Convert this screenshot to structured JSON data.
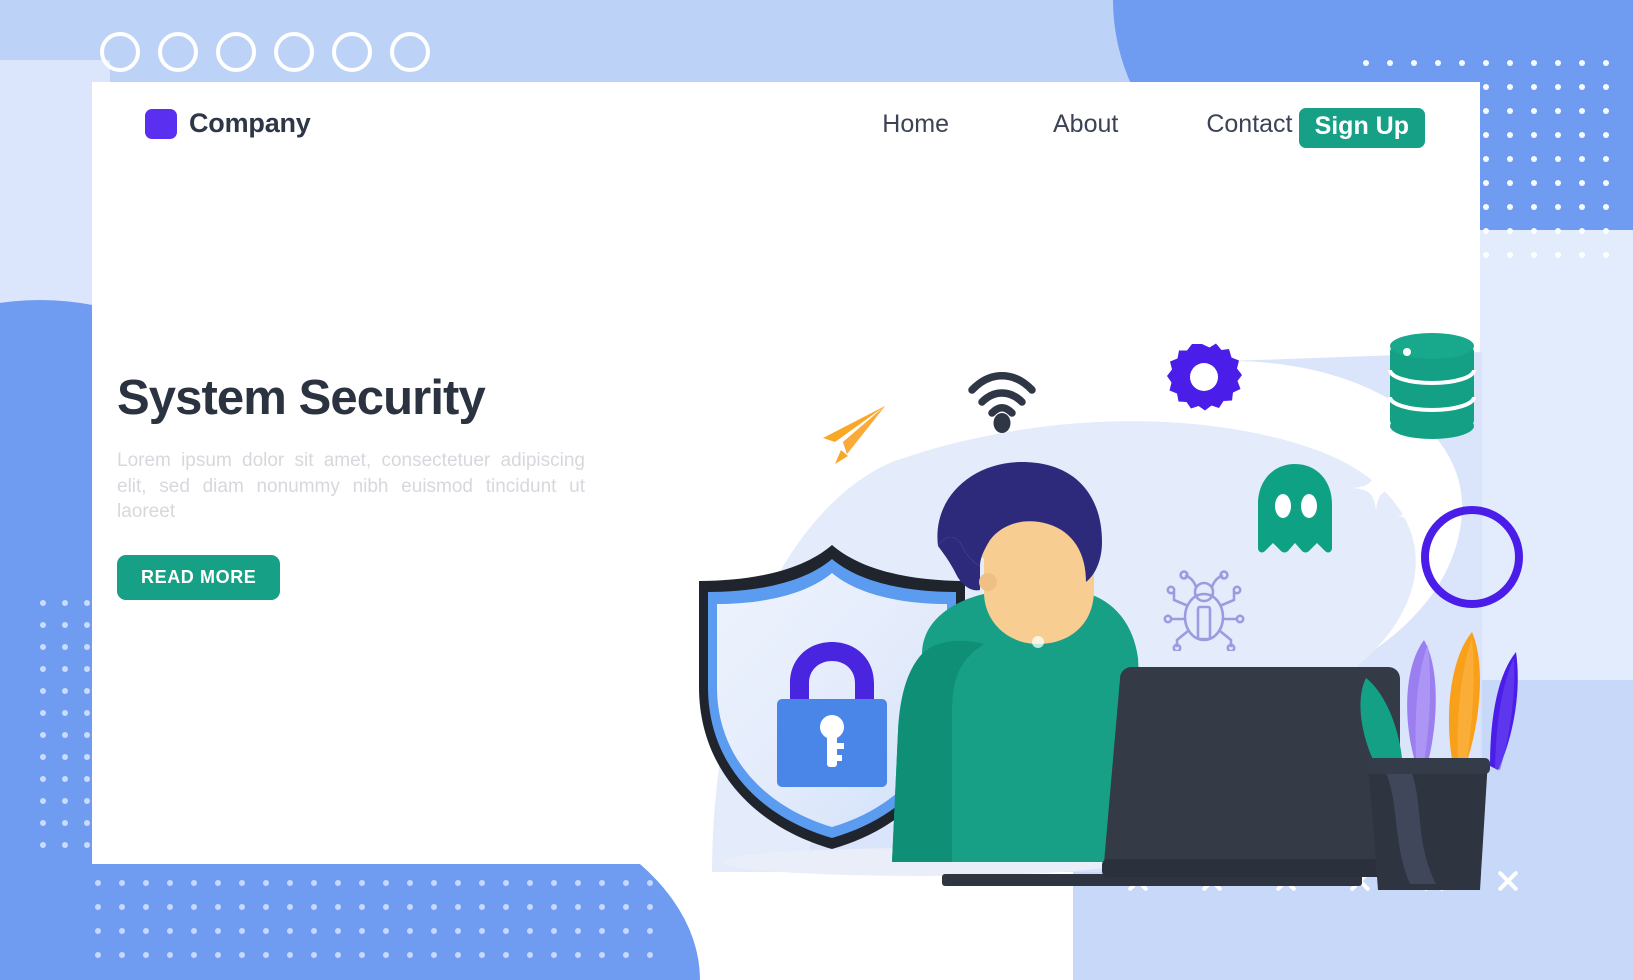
{
  "page": {
    "title": "System Security landing page"
  },
  "navbar": {
    "brand": "Company",
    "brand_mark_icon": "square-logo-icon",
    "brand_color": "#5b2ff0",
    "links": [
      {
        "label": "Home"
      },
      {
        "label": "About"
      },
      {
        "label": "Contact Us"
      }
    ],
    "signup_label": "Sign Up",
    "signup_color": "#16a085"
  },
  "hero": {
    "title": "System Security",
    "subtitle": "Lorem ipsum dolor sit amet, consectetuer adipiscing elit, sed diam nonummy nibh euismod tincidunt ut laoreet",
    "cta_label": "READ MORE",
    "cta_color": "#16a085",
    "title_color": "#2b3240",
    "subtitle_color": "#d6d8dd"
  },
  "illustration": {
    "description": "Man working on laptop with security shield and floating tech icons",
    "icons": [
      {
        "name": "paper-plane-icon",
        "color": "#f5a623"
      },
      {
        "name": "wifi-icon",
        "color": "#2f3747"
      },
      {
        "name": "gear-icon",
        "color": "#4a1ee8"
      },
      {
        "name": "database-icon",
        "color": "#14a085"
      },
      {
        "name": "ghost-icon",
        "color": "#0fa184"
      },
      {
        "name": "sparkle-icon",
        "color": "#ffffff"
      },
      {
        "name": "bug-icon",
        "color": "#9b9be0"
      },
      {
        "name": "circle-ring-icon",
        "color": "#4a1ee8"
      },
      {
        "name": "shield-lock-icon",
        "color": "#4a90e2"
      },
      {
        "name": "laptop-icon",
        "color": "#343a46"
      },
      {
        "name": "pencil-cup-icon",
        "color": "#2f3540"
      }
    ],
    "palette": {
      "hair": "#2d2a7c",
      "skin": "#f7cd91",
      "shirt": "#17a085",
      "shirt_shade": "#0f8f76",
      "laptop": "#343a46",
      "shield_outline": "#20242d",
      "shield_border": "#5b9cf0",
      "lock_body": "#4a86e8",
      "lock_shackle": "#4a25e0",
      "blob": "#d8e3fa"
    }
  },
  "decorations": {
    "top_circles_count": 6,
    "x_marks_count": 6,
    "circle_color": "#ffffff",
    "bg_blue": "#6f9bf0",
    "bg_pale_blue": "#dbe6fc"
  }
}
